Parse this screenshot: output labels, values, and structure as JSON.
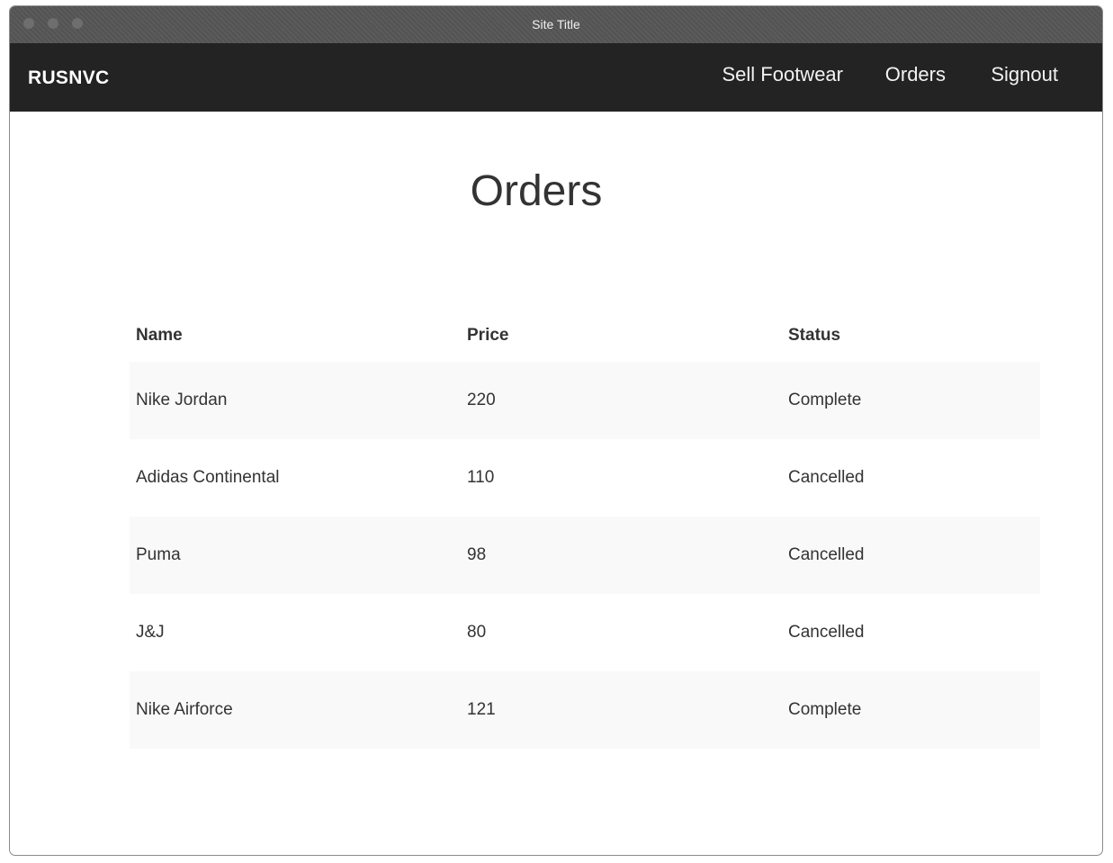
{
  "window": {
    "title": "Site Title"
  },
  "navbar": {
    "brand": "RUSNVC",
    "links": [
      {
        "label": "Sell Footwear"
      },
      {
        "label": "Orders"
      },
      {
        "label": "Signout"
      }
    ]
  },
  "page": {
    "title": "Orders"
  },
  "orders_table": {
    "headers": [
      "Name",
      "Price",
      "Status"
    ],
    "rows": [
      {
        "name": "Nike Jordan",
        "price": "220",
        "status": "Complete"
      },
      {
        "name": "Adidas Continental",
        "price": "110",
        "status": "Cancelled"
      },
      {
        "name": "Puma",
        "price": "98",
        "status": "Cancelled"
      },
      {
        "name": "J&J",
        "price": "80",
        "status": "Cancelled"
      },
      {
        "name": "Nike Airforce",
        "price": "121",
        "status": "Complete"
      }
    ]
  },
  "colors": {
    "navbar_bg": "#232323",
    "titlebar_bg": "#565656",
    "striped_row_bg": "#f9f9f9",
    "text": "#333333"
  }
}
